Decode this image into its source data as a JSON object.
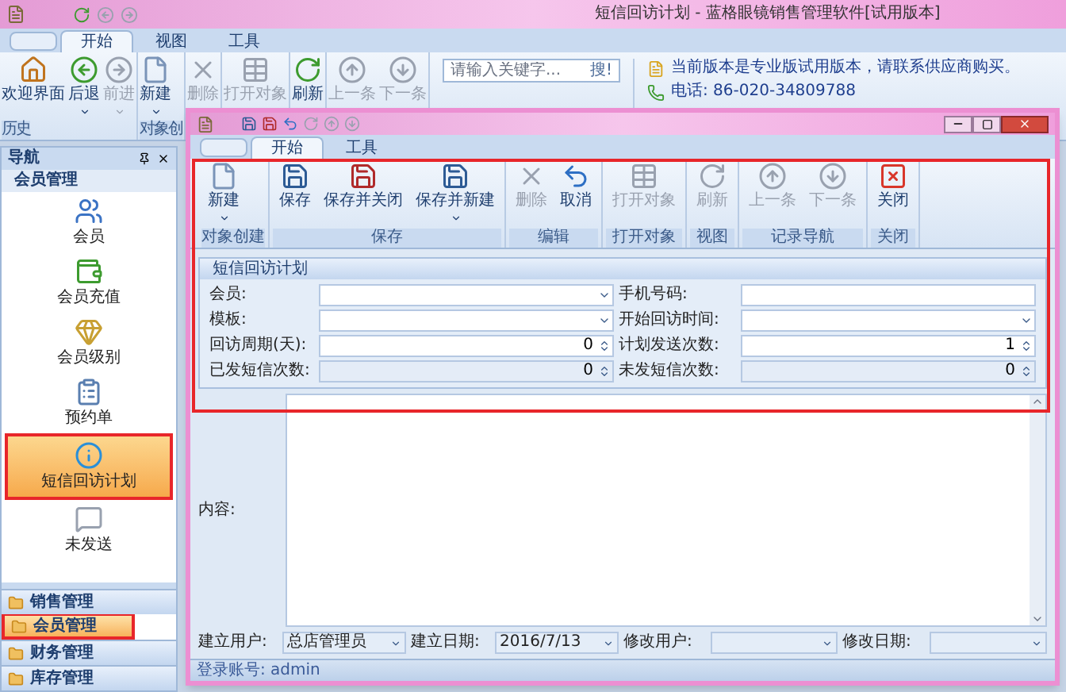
{
  "window": {
    "title": "短信回访计划 - 蓝格眼镜销售管理软件[试用版本]"
  },
  "ribbon": {
    "tabs": [
      {
        "label": "开始",
        "selected": true
      },
      {
        "label": "视图",
        "selected": false
      },
      {
        "label": "工具",
        "selected": false
      }
    ],
    "groups": [
      {
        "label": "历史",
        "buttons": [
          {
            "label": "欢迎界面",
            "disabled": false,
            "dropdown": false
          },
          {
            "label": "后退",
            "disabled": false,
            "dropdown": true
          },
          {
            "label": "前进",
            "disabled": true,
            "dropdown": true
          }
        ]
      },
      {
        "label": "对象创",
        "buttons": [
          {
            "label": "新建",
            "disabled": false,
            "dropdown": true
          }
        ]
      },
      {
        "buttons": [
          {
            "label": "删除",
            "disabled": true,
            "dropdown": false
          }
        ]
      },
      {
        "buttons": [
          {
            "label": "打开对象",
            "disabled": true,
            "dropdown": false
          }
        ]
      },
      {
        "buttons": [
          {
            "label": "刷新",
            "disabled": false,
            "dropdown": false
          }
        ]
      },
      {
        "buttons": [
          {
            "label": "上一条",
            "disabled": true,
            "dropdown": false
          },
          {
            "label": "下一条",
            "disabled": true,
            "dropdown": false
          }
        ]
      }
    ],
    "search": {
      "placeholder": "请输入关键字...",
      "button": "搜!"
    },
    "notices": [
      "当前版本是专业版试用版本，请联系供应商购买。",
      "电话:  86-020-34809788"
    ]
  },
  "nav": {
    "title": "导航",
    "group": "会员管理",
    "items": [
      {
        "label": "会员",
        "selected": false
      },
      {
        "label": "会员充值",
        "selected": false
      },
      {
        "label": "会员级别",
        "selected": false
      },
      {
        "label": "预约单",
        "selected": false
      },
      {
        "label": "短信回访计划",
        "selected": true
      },
      {
        "label": "未发送",
        "selected": false
      }
    ],
    "sections": [
      {
        "label": "销售管理",
        "selected": false
      },
      {
        "label": "会员管理",
        "selected": true
      },
      {
        "label": "财务管理",
        "selected": false
      },
      {
        "label": "库存管理",
        "selected": false
      }
    ]
  },
  "child": {
    "tabs": [
      {
        "label": "开始",
        "selected": true
      },
      {
        "label": "工具",
        "selected": false
      }
    ],
    "groups": [
      {
        "label": "对象创建",
        "buttons": [
          {
            "label": "新建",
            "disabled": false,
            "dropdown": true
          }
        ]
      },
      {
        "label": "保存",
        "buttons": [
          {
            "label": "保存",
            "disabled": false,
            "dropdown": false
          },
          {
            "label": "保存并关闭",
            "disabled": false,
            "dropdown": false
          },
          {
            "label": "保存并新建",
            "disabled": false,
            "dropdown": true
          }
        ]
      },
      {
        "label": "编辑",
        "buttons": [
          {
            "label": "删除",
            "disabled": true,
            "dropdown": false
          },
          {
            "label": "取消",
            "disabled": false,
            "dropdown": false
          }
        ]
      },
      {
        "label": "打开对象",
        "buttons": [
          {
            "label": "打开对象",
            "disabled": true,
            "dropdown": false
          }
        ]
      },
      {
        "label": "视图",
        "buttons": [
          {
            "label": "刷新",
            "disabled": true,
            "dropdown": false
          }
        ]
      },
      {
        "label": "记录导航",
        "buttons": [
          {
            "label": "上一条",
            "disabled": true,
            "dropdown": false
          },
          {
            "label": "下一条",
            "disabled": true,
            "dropdown": false
          }
        ]
      },
      {
        "label": "关闭",
        "buttons": [
          {
            "label": "关闭",
            "disabled": false,
            "dropdown": false
          }
        ]
      }
    ],
    "form": {
      "title": "短信回访计划",
      "fields": [
        {
          "label": "会员:",
          "kind": "combo",
          "disabled": false
        },
        {
          "label": "手机号码:",
          "kind": "text",
          "disabled": false
        },
        {
          "label": "模板:",
          "kind": "combo",
          "disabled": false
        },
        {
          "label": "开始回访时间:",
          "kind": "combo",
          "disabled": false
        },
        {
          "label": "回访周期(天):",
          "kind": "spin",
          "value": "0",
          "disabled": false
        },
        {
          "label": "计划发送次数:",
          "kind": "spin",
          "value": "1",
          "disabled": false
        },
        {
          "label": "已发短信次数:",
          "kind": "spin",
          "value": "0",
          "disabled": true
        },
        {
          "label": "未发短信次数:",
          "kind": "spin",
          "value": "0",
          "disabled": true
        }
      ]
    },
    "content_label": "内容:",
    "footer": [
      {
        "label": "建立用户:",
        "value": "总店管理员"
      },
      {
        "label": "建立日期:",
        "value": "2016/7/13"
      },
      {
        "label": "修改用户:"
      },
      {
        "label": "修改日期:"
      }
    ],
    "status": "登录账号: admin"
  }
}
